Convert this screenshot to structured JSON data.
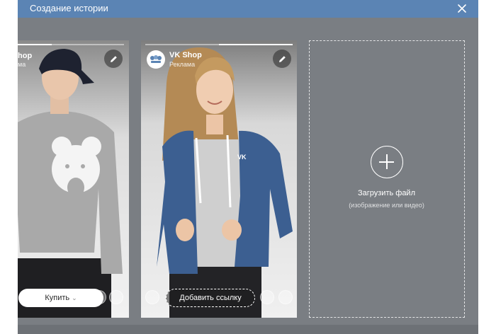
{
  "modal": {
    "title": "Создание истории",
    "close_icon": "close-icon"
  },
  "stories": [
    {
      "brand_name_partial": "hop",
      "brand_sub_partial": "ма",
      "progress": 0.45,
      "button_label": "Купить",
      "button_caret": "⌄",
      "edit_icon": "pencil-icon"
    },
    {
      "brand_name": "VK Shop",
      "brand_sub": "Реклама",
      "progress": 0.5,
      "button_label": "Добавить ссылку",
      "edit_icon": "pencil-icon"
    }
  ],
  "upload": {
    "title": "Загрузить файл",
    "subtitle": "(изображение или видео)",
    "icon": "plus-circle-icon"
  },
  "colors": {
    "header": "#5b84b4",
    "backdrop": "#7a7e83",
    "sweater_grey": "#a9a9a9",
    "hoodie_blue": "#3c5f91"
  }
}
